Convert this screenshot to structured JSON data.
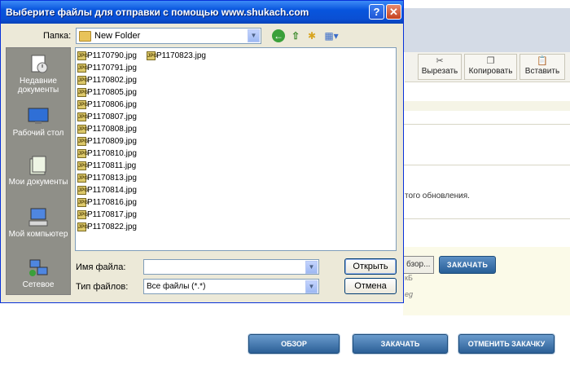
{
  "dialog": {
    "title": "Выберите файлы для отправки с помощью www.shukach.com",
    "help_symbol": "?",
    "close_symbol": "✕",
    "look_in_label": "Папка:",
    "look_in_value": "New Folder",
    "filename_label": "Имя файла:",
    "filename_value": "",
    "filetype_label": "Тип файлов:",
    "filetype_value": "Все файлы (*.*)",
    "open_label": "Открыть",
    "cancel_label": "Отмена",
    "places": [
      {
        "label": "Недавние документы",
        "icon": "recent-documents-icon"
      },
      {
        "label": "Рабочий стол",
        "icon": "desktop-icon"
      },
      {
        "label": "Мои документы",
        "icon": "my-documents-icon"
      },
      {
        "label": "Мой компьютер",
        "icon": "my-computer-icon"
      },
      {
        "label": "Сетевое",
        "icon": "network-icon"
      }
    ],
    "file_icon_text": "JPG",
    "files": [
      "P1170790.jpg",
      "P1170791.jpg",
      "P1170802.jpg",
      "P1170805.jpg",
      "P1170806.jpg",
      "P1170807.jpg",
      "P1170808.jpg",
      "P1170809.jpg",
      "P1170810.jpg",
      "P1170811.jpg",
      "P1170813.jpg",
      "P1170814.jpg",
      "P1170816.jpg",
      "P1170817.jpg",
      "P1170822.jpg",
      "P1170823.jpg"
    ]
  },
  "background_page": {
    "toolbar": {
      "cut_label": "Вырезать",
      "copy_label": "Копировать",
      "paste_label": "Вставить"
    },
    "update_text": "того обновления.",
    "browse_partial": "бзор...",
    "upload_small": "ЗАКАЧАТЬ",
    "size_partial": "кБ",
    "ext_partial": "eg",
    "bottom_buttons": {
      "browse": "ОБЗОР",
      "upload": "ЗАКАЧАТЬ",
      "cancel_upload": "ОТМЕНИТЬ ЗАКАЧКУ"
    }
  },
  "colors": {
    "titlebar": "#0855dd",
    "dialog_face": "#ece9d8",
    "button_blue": "#2b5f96"
  }
}
